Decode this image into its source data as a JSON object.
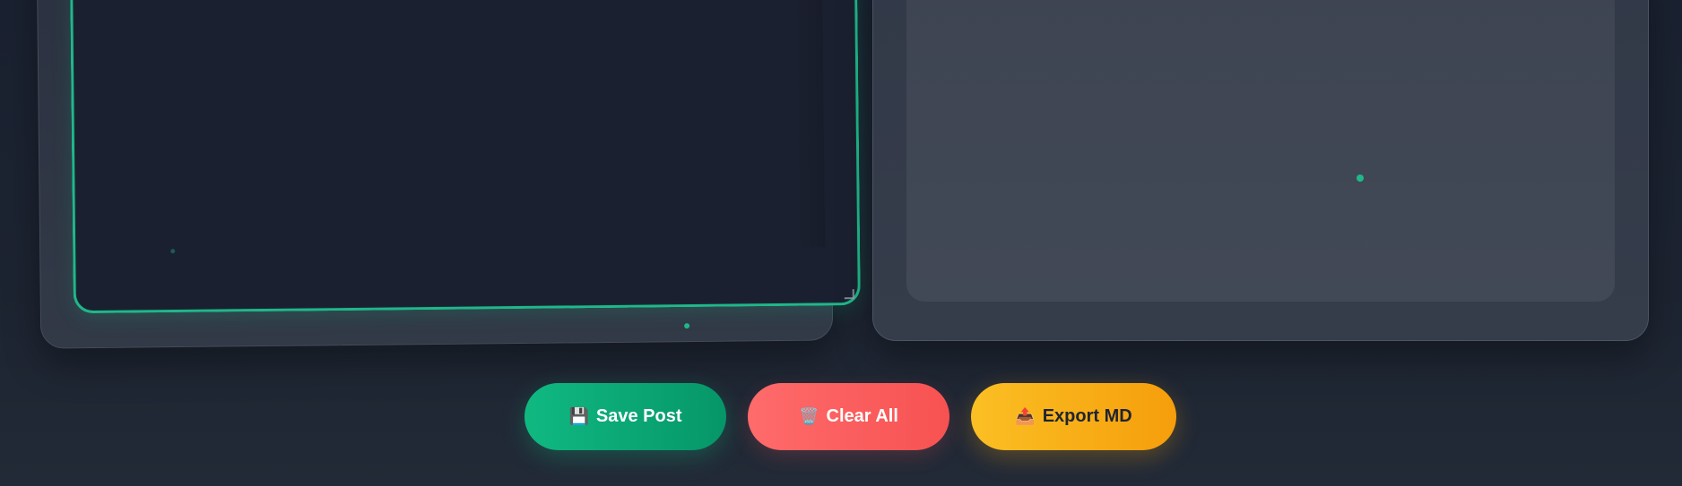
{
  "buttons": {
    "save": {
      "icon": "💾",
      "label": "Save Post"
    },
    "clear": {
      "icon": "🗑️",
      "label": "Clear All"
    },
    "export": {
      "icon": "📤",
      "label": "Export MD"
    }
  },
  "colors": {
    "accent": "#10b981",
    "danger": "#f75252",
    "warning": "#f59e0b",
    "background": "#1d2431"
  },
  "icons": {
    "save": "floppy-disk-icon",
    "clear": "trash-icon",
    "export": "outbox-tray-icon"
  }
}
